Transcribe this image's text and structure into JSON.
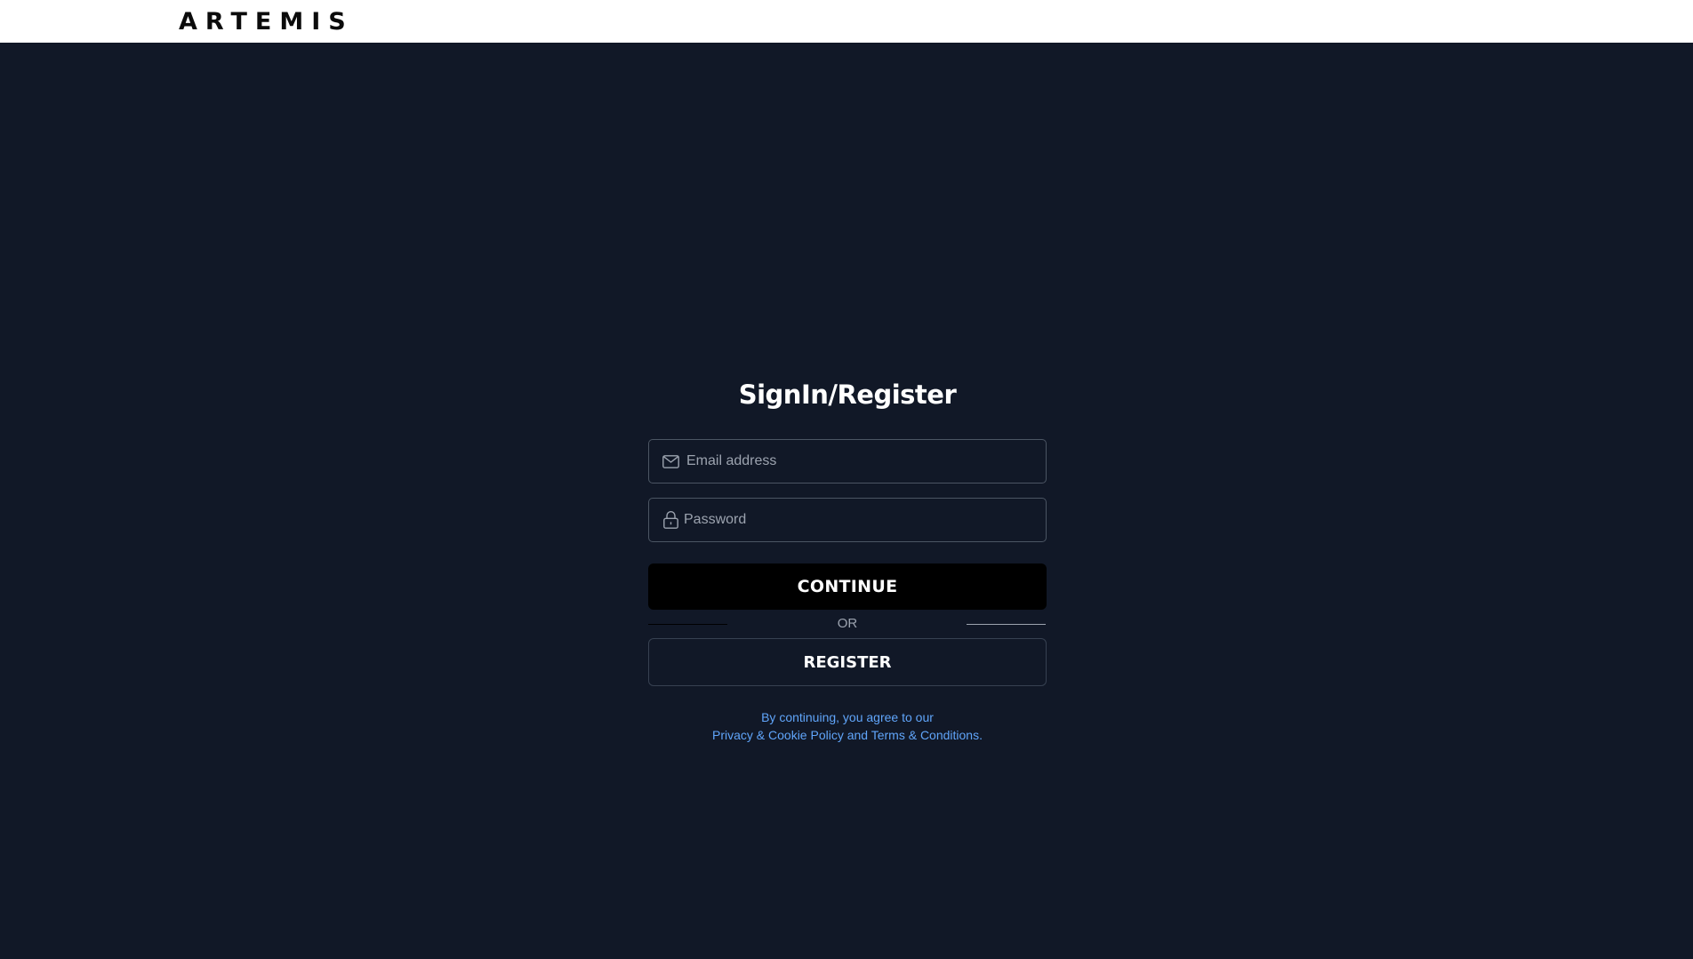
{
  "header": {
    "logo_text": "ARTEMIS"
  },
  "form": {
    "title": "SignIn/Register",
    "email": {
      "placeholder": "Email address",
      "value": "",
      "icon": "mail-icon"
    },
    "password": {
      "placeholder": "Password",
      "value": "",
      "icon": "lock-icon"
    },
    "continue_label": "CONTINUE",
    "divider_label": "OR",
    "register_label": "REGISTER",
    "legal": {
      "line1": "By continuing, you agree to our",
      "privacy_link": "Privacy & Cookie Policy",
      "and": " and ",
      "terms_link": "Terms & Conditions",
      "period": "."
    }
  },
  "colors": {
    "background": "#111827",
    "header_bg": "#ffffff",
    "link": "#60a5fa",
    "button_primary": "#000000"
  }
}
